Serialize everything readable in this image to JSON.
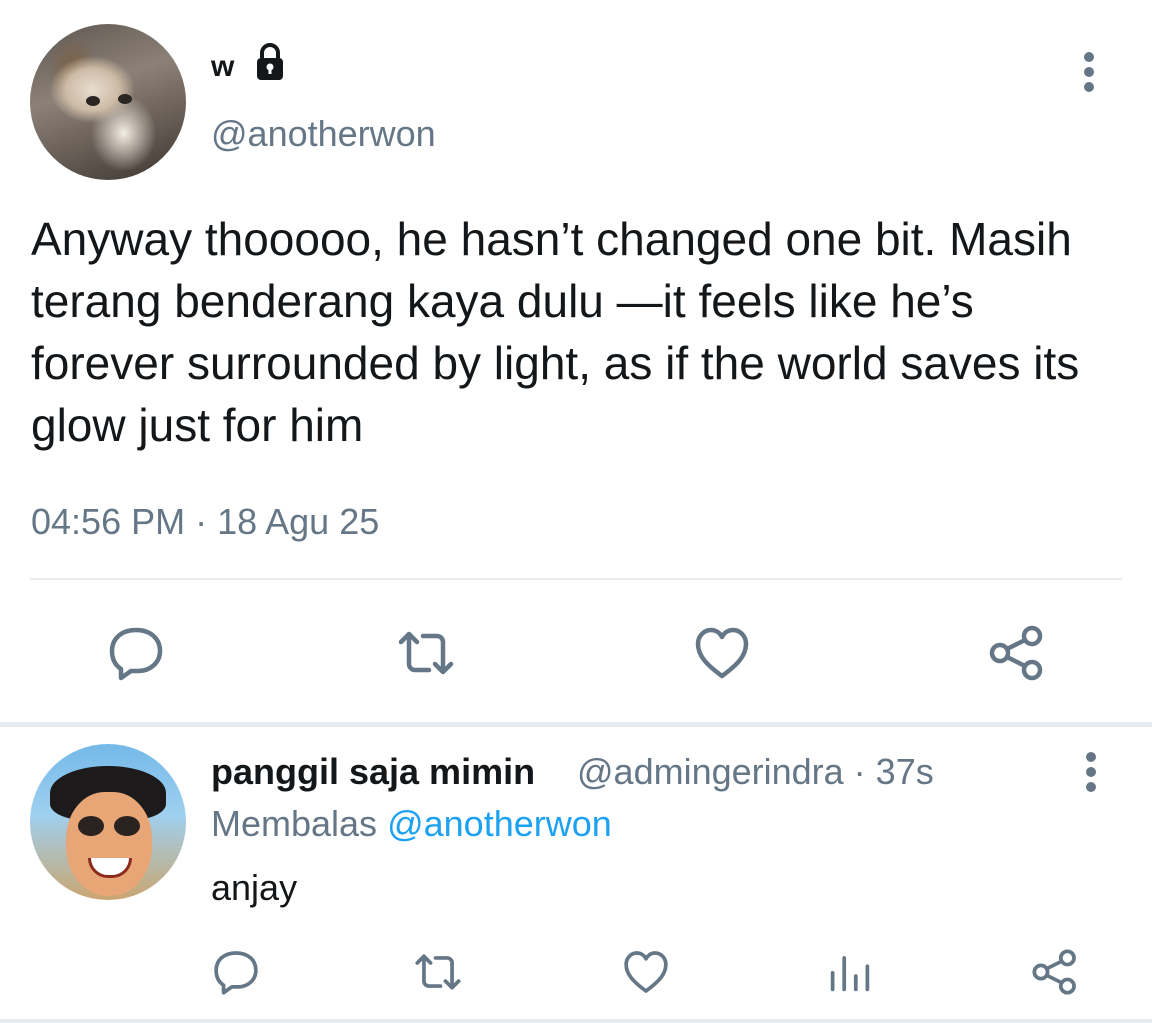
{
  "main_tweet": {
    "display_name": "w",
    "handle": "@anotherwon",
    "text": "Anyway thooooo, he hasn’t changed one bit. Masih terang benderang kaya dulu —it feels like he’s forever surrounded by light, as if the world saves its glow just for him",
    "timestamp": "04:56 PM · 18 Agu 25",
    "icons": [
      "lock-icon",
      "more-icon",
      "reply-icon",
      "retweet-icon",
      "like-icon",
      "share-icon"
    ]
  },
  "reply": {
    "display_name": "panggil saja mimin",
    "meta": "@admingerindra · 37s",
    "replying_prefix": "Membalas",
    "replying_to": "@anotherwon",
    "text": "anjay",
    "icons": [
      "reply-icon",
      "retweet-icon",
      "like-icon",
      "analytics-icon",
      "share-icon",
      "more-icon"
    ]
  },
  "colors": {
    "text": "#14171a",
    "secondary": "#657786",
    "link": "#1da1f2",
    "divider": "#e6ecf0"
  }
}
